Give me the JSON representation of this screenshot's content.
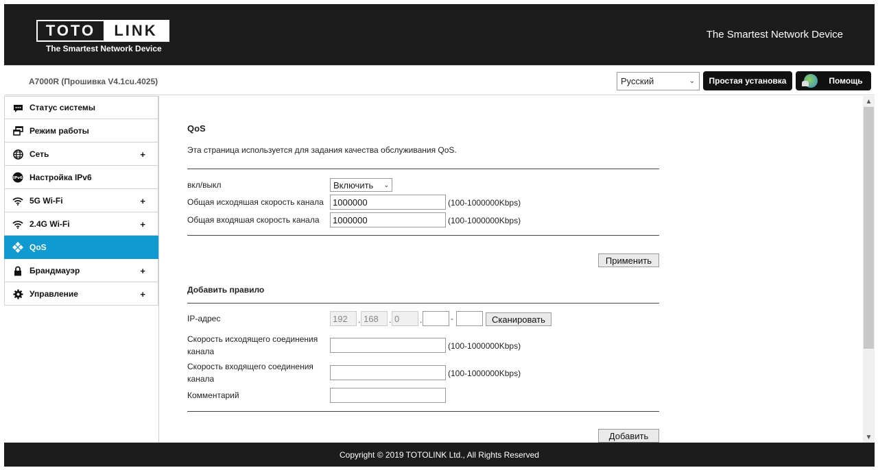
{
  "header": {
    "logo_left": "TOTO",
    "logo_right": "LINK",
    "logo_tagline": "The Smartest Network Device",
    "slogan": "The Smartest Network Device"
  },
  "topbar": {
    "firmware": "A7000R (Прошивка V4.1cu.4025)",
    "language": "Русский",
    "setup_label": "Простая установка",
    "help_label": "Помощь"
  },
  "sidebar": {
    "items": [
      {
        "label": "Статус системы",
        "icon": "chat-icon"
      },
      {
        "label": "Режим работы",
        "icon": "windows-icon"
      },
      {
        "label": "Сеть",
        "icon": "globe-icon",
        "plus": "+"
      },
      {
        "label": "Настройка IPv6",
        "icon": "ipv6-icon",
        "icon_text": "IPv6"
      },
      {
        "label": "5G Wi-Fi",
        "icon": "wifi-icon",
        "plus": "+"
      },
      {
        "label": "2.4G Wi-Fi",
        "icon": "wifi-icon",
        "plus": "+"
      },
      {
        "label": "QoS",
        "icon": "qos-icon"
      },
      {
        "label": "Брандмауэр",
        "icon": "lock-icon",
        "plus": "+"
      },
      {
        "label": "Управление",
        "icon": "gear-icon",
        "plus": "+"
      }
    ]
  },
  "qos": {
    "title": "QoS",
    "description": "Эта страница используется для задания качества обслуживания QoS.",
    "enable_label": "вкл/выкл",
    "enable_value": "Включить",
    "upload_label": "Общая исходяшая скорость канала",
    "upload_value": "1000000",
    "download_label": "Общая входяшая скорость канала",
    "download_value": "1000000",
    "range_hint": "(100-1000000Kbps)",
    "apply_label": "Применить"
  },
  "rule": {
    "title": "Добавить правило",
    "ip_label": "IP-адрес",
    "ip_octets": [
      "192",
      "168",
      "0"
    ],
    "ip_dot": ".",
    "ip_dash": "-",
    "scan_label": "Сканировать",
    "up_label": "Скорость исходящего соединения канала",
    "down_label": "Скорость входящего соединения канала",
    "range_hint": "(100-1000000Kbps)",
    "comment_label": "Комментарий",
    "add_label": "Добавить"
  },
  "footer": {
    "copyright": "Copyright © 2019 TOTOLINK Ltd., All Rights Reserved"
  },
  "colors": {
    "header_bg": "#1c1c1c",
    "accent": "#0f9bd1"
  }
}
